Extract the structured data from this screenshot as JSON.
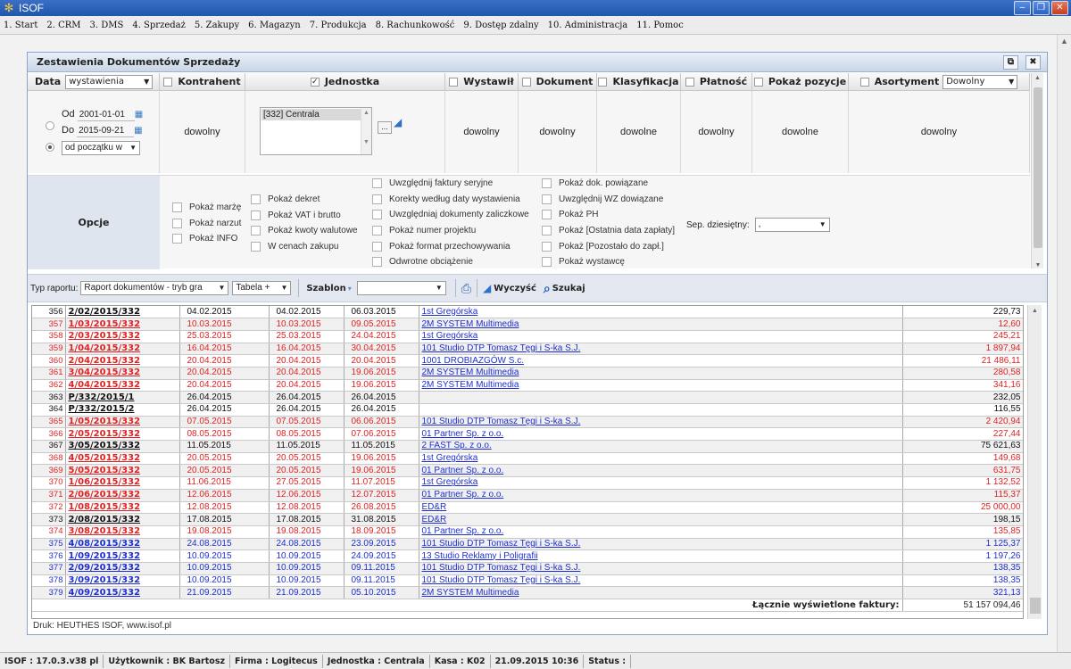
{
  "app": {
    "title": "ISOF"
  },
  "menu": [
    "1. Start",
    "2. CRM",
    "3. DMS",
    "4. Sprzedaż",
    "5. Zakupy",
    "6. Magazyn",
    "7. Produkcja",
    "8. Rachunkowość",
    "9. Dostęp zdalny",
    "10. Administracja",
    "11. Pomoc"
  ],
  "panel": {
    "title": "Zestawienia Dokumentów Sprzedaży"
  },
  "filters": {
    "data_label": "Data",
    "data_select": "wystawienia",
    "od_label": "Od",
    "od_value": "2001-01-01",
    "do_label": "Do",
    "do_value": "2015-09-21",
    "range_select": "od początku w",
    "kontrahent": {
      "label": "Kontrahent",
      "value": "dowolny"
    },
    "jednostka": {
      "label": "Jednostka",
      "value": "[332] Centrala"
    },
    "wystawil": {
      "label": "Wystawił",
      "value": "dowolny"
    },
    "dokument": {
      "label": "Dokument",
      "value": "dowolny"
    },
    "klasyfikacja": {
      "label": "Klasyfikacja",
      "value": "dowolne"
    },
    "platnosc": {
      "label": "Płatność",
      "value": "dowolny"
    },
    "pokaz_pozycje": {
      "label": "Pokaż pozycje",
      "value": "dowolne"
    },
    "asortyment": {
      "label": "Asortyment",
      "select": "Dowolny",
      "value": "dowolny"
    }
  },
  "options": {
    "label": "Opcje",
    "col1": [
      "Pokaż marżę",
      "Pokaż narzut",
      "Pokaż INFO"
    ],
    "col2": [
      "Pokaż dekret",
      "Pokaż VAT i brutto",
      "Pokaż kwoty walutowe",
      "W cenach zakupu"
    ],
    "col3": [
      "Uwzględnij faktury seryjne",
      "Korekty według daty wystawienia",
      "Uwzględniaj dokumenty zaliczkowe",
      "Pokaż numer projektu",
      "Pokaż format przechowywania",
      "Odwrotne obciążenie"
    ],
    "col4": [
      "Pokaż dok. powiązane",
      "Uwzględnij WZ dowiązane",
      "Pokaż PH",
      "Pokaż [Ostatnia data zapłaty]",
      "Pokaż [Pozostało do zapł.]",
      "Pokaż wystawcę"
    ],
    "sep_label": "Sep. dziesiętny:",
    "sep_value": ","
  },
  "toolbar": {
    "typ_label": "Typ raportu:",
    "typ_value": "Raport dokumentów - tryb gra",
    "tabela_value": "Tabela +",
    "szablon_label": "Szablon",
    "szablon_value": "",
    "wyczysc": "Wyczyść",
    "szukaj": "Szukaj"
  },
  "table": {
    "rows": [
      {
        "lp": "356",
        "doc": "2/02/2015/332",
        "d1": "04.02.2015",
        "d2": "04.02.2015",
        "d3": "06.03.2015",
        "k": "1st Gregórska",
        "v": "229,73",
        "c": "blk"
      },
      {
        "lp": "357",
        "doc": "1/03/2015/332",
        "d1": "10.03.2015",
        "d2": "10.03.2015",
        "d3": "09.05.2015",
        "k": "2M SYSTEM Multimedia",
        "v": "12,60",
        "c": "red"
      },
      {
        "lp": "358",
        "doc": "2/03/2015/332",
        "d1": "25.03.2015",
        "d2": "25.03.2015",
        "d3": "24.04.2015",
        "k": "1st Gregórska",
        "v": "245,21",
        "c": "red"
      },
      {
        "lp": "359",
        "doc": "1/04/2015/332",
        "d1": "16.04.2015",
        "d2": "16.04.2015",
        "d3": "30.04.2015",
        "k": "101 Studio DTP Tomasz Tęgi i S-ka S.J.",
        "v": "1 897,94",
        "c": "red"
      },
      {
        "lp": "360",
        "doc": "2/04/2015/332",
        "d1": "20.04.2015",
        "d2": "20.04.2015",
        "d3": "20.04.2015",
        "k": "1001 DROBIAZGÓW S.c.",
        "v": "21 486,11",
        "c": "red"
      },
      {
        "lp": "361",
        "doc": "3/04/2015/332",
        "d1": "20.04.2015",
        "d2": "20.04.2015",
        "d3": "19.06.2015",
        "k": "2M SYSTEM Multimedia",
        "v": "280,58",
        "c": "red"
      },
      {
        "lp": "362",
        "doc": "4/04/2015/332",
        "d1": "20.04.2015",
        "d2": "20.04.2015",
        "d3": "19.06.2015",
        "k": "2M SYSTEM Multimedia",
        "v": "341,16",
        "c": "red"
      },
      {
        "lp": "363",
        "doc": "P/332/2015/1",
        "d1": "26.04.2015",
        "d2": "26.04.2015",
        "d3": "26.04.2015",
        "k": "",
        "v": "232,05",
        "c": "blk"
      },
      {
        "lp": "364",
        "doc": "P/332/2015/2",
        "d1": "26.04.2015",
        "d2": "26.04.2015",
        "d3": "26.04.2015",
        "k": "",
        "v": "116,55",
        "c": "blk"
      },
      {
        "lp": "365",
        "doc": "1/05/2015/332",
        "d1": "07.05.2015",
        "d2": "07.05.2015",
        "d3": "06.06.2015",
        "k": "101 Studio DTP Tomasz Tęgi i S-ka S.J.",
        "v": "2 420,94",
        "c": "red"
      },
      {
        "lp": "366",
        "doc": "2/05/2015/332",
        "d1": "08.05.2015",
        "d2": "08.05.2015",
        "d3": "07.06.2015",
        "k": "01 Partner Sp. z o.o.",
        "v": "227,44",
        "c": "red"
      },
      {
        "lp": "367",
        "doc": "3/05/2015/332",
        "d1": "11.05.2015",
        "d2": "11.05.2015",
        "d3": "11.05.2015",
        "k": "2 FAST Sp. z o.o.",
        "v": "75 621,63",
        "c": "blk"
      },
      {
        "lp": "368",
        "doc": "4/05/2015/332",
        "d1": "20.05.2015",
        "d2": "20.05.2015",
        "d3": "19.06.2015",
        "k": "1st Gregórska",
        "v": "149,68",
        "c": "red"
      },
      {
        "lp": "369",
        "doc": "5/05/2015/332",
        "d1": "20.05.2015",
        "d2": "20.05.2015",
        "d3": "19.06.2015",
        "k": "01 Partner Sp. z o.o.",
        "v": "631,75",
        "c": "red"
      },
      {
        "lp": "370",
        "doc": "1/06/2015/332",
        "d1": "11.06.2015",
        "d2": "27.05.2015",
        "d3": "11.07.2015",
        "k": "1st Gregórska",
        "v": "1 132,52",
        "c": "red"
      },
      {
        "lp": "371",
        "doc": "2/06/2015/332",
        "d1": "12.06.2015",
        "d2": "12.06.2015",
        "d3": "12.07.2015",
        "k": "01 Partner Sp. z o.o.",
        "v": "115,37",
        "c": "red"
      },
      {
        "lp": "372",
        "doc": "1/08/2015/332",
        "d1": "12.08.2015",
        "d2": "12.08.2015",
        "d3": "26.08.2015",
        "k": "ED&R",
        "v": "25 000,00",
        "c": "red"
      },
      {
        "lp": "373",
        "doc": "2/08/2015/332",
        "d1": "17.08.2015",
        "d2": "17.08.2015",
        "d3": "31.08.2015",
        "k": "ED&R",
        "v": "198,15",
        "c": "blk"
      },
      {
        "lp": "374",
        "doc": "3/08/2015/332",
        "d1": "19.08.2015",
        "d2": "19.08.2015",
        "d3": "18.09.2015",
        "k": "01 Partner Sp. z o.o.",
        "v": "135,85",
        "c": "red"
      },
      {
        "lp": "375",
        "doc": "4/08/2015/332",
        "d1": "24.08.2015",
        "d2": "24.08.2015",
        "d3": "23.09.2015",
        "k": "101 Studio DTP Tomasz Tęgi i S-ka S.J.",
        "v": "1 125,37",
        "c": "blue"
      },
      {
        "lp": "376",
        "doc": "1/09/2015/332",
        "d1": "10.09.2015",
        "d2": "10.09.2015",
        "d3": "24.09.2015",
        "k": "13 Studio Reklamy i Poligrafii",
        "v": "1 197,26",
        "c": "blue"
      },
      {
        "lp": "377",
        "doc": "2/09/2015/332",
        "d1": "10.09.2015",
        "d2": "10.09.2015",
        "d3": "09.11.2015",
        "k": "101 Studio DTP Tomasz Tęgi i S-ka S.J.",
        "v": "138,35",
        "c": "blue"
      },
      {
        "lp": "378",
        "doc": "3/09/2015/332",
        "d1": "10.09.2015",
        "d2": "10.09.2015",
        "d3": "09.11.2015",
        "k": "101 Studio DTP Tomasz Tęgi i S-ka S.J.",
        "v": "138,35",
        "c": "blue"
      },
      {
        "lp": "379",
        "doc": "4/09/2015/332",
        "d1": "21.09.2015",
        "d2": "21.09.2015",
        "d3": "05.10.2015",
        "k": "2M SYSTEM Multimedia",
        "v": "321,13",
        "c": "blue"
      }
    ],
    "sum_label": "Łącznie wyświetlone faktury:",
    "sum_value": "51 157 094,46"
  },
  "footer": {
    "note": "Druk: HEUTHES ISOF, www.isof.pl"
  },
  "status": [
    "ISOF : 17.0.3.v38 pl",
    "Użytkownik : BK Bartosz",
    "Firma : Logitecus",
    "Jednostka : Centrala",
    "Kasa : K02",
    "21.09.2015 10:36",
    "Status :"
  ]
}
